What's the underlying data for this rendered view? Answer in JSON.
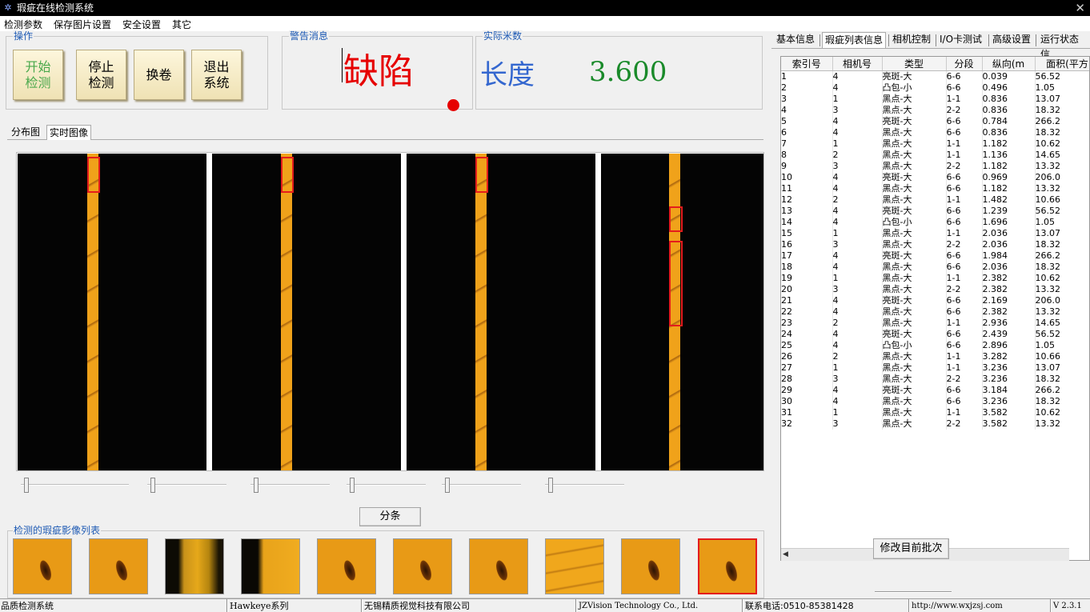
{
  "window": {
    "title": "瑕疵在线检测系统",
    "close_glyph": "✕"
  },
  "menu": [
    "检测参数",
    "保存图片设置",
    "安全设置",
    "其它"
  ],
  "operation": {
    "title": "操作",
    "start": [
      "开始",
      "检测"
    ],
    "stop": [
      "停止",
      "检测"
    ],
    "change_roll": "换卷",
    "exit": [
      "退出",
      "系统"
    ]
  },
  "warning": {
    "title": "警告消息",
    "message": "缺陷",
    "indicator_color": "#e60000"
  },
  "meter": {
    "title": "实际米数",
    "label": "长度",
    "value": "3.600"
  },
  "view_tabs": {
    "distribution": "分布图",
    "realtime": "实时图像",
    "active": "实时图像"
  },
  "split_button": "分条",
  "thumbs_title": "检测的瑕疵影像列表",
  "right_tabs": [
    "基本信息",
    "瑕疵列表信息",
    "相机控制",
    "I/O卡测试",
    "高级设置",
    "运行状态信"
  ],
  "right_active_tab": "瑕疵列表信息",
  "table": {
    "headers": [
      "索引号",
      "相机号",
      "类型",
      "分段",
      "纵向(m",
      "面积(平方"
    ],
    "rows": [
      [
        "1",
        "4",
        "亮斑-大",
        "6-6",
        "0.039",
        "56.52"
      ],
      [
        "2",
        "4",
        "凸包-小",
        "6-6",
        "0.496",
        "1.05"
      ],
      [
        "3",
        "1",
        "黑点-大",
        "1-1",
        "0.836",
        "13.07"
      ],
      [
        "4",
        "3",
        "黑点-大",
        "2-2",
        "0.836",
        "18.32"
      ],
      [
        "5",
        "4",
        "亮斑-大",
        "6-6",
        "0.784",
        "266.2"
      ],
      [
        "6",
        "4",
        "黑点-大",
        "6-6",
        "0.836",
        "18.32"
      ],
      [
        "7",
        "1",
        "黑点-大",
        "1-1",
        "1.182",
        "10.62"
      ],
      [
        "8",
        "2",
        "黑点-大",
        "1-1",
        "1.136",
        "14.65"
      ],
      [
        "9",
        "3",
        "黑点-大",
        "2-2",
        "1.182",
        "13.32"
      ],
      [
        "10",
        "4",
        "亮斑-大",
        "6-6",
        "0.969",
        "206.0"
      ],
      [
        "11",
        "4",
        "黑点-大",
        "6-6",
        "1.182",
        "13.32"
      ],
      [
        "12",
        "2",
        "黑点-大",
        "1-1",
        "1.482",
        "10.66"
      ],
      [
        "13",
        "4",
        "亮斑-大",
        "6-6",
        "1.239",
        "56.52"
      ],
      [
        "14",
        "4",
        "凸包-小",
        "6-6",
        "1.696",
        "1.05"
      ],
      [
        "15",
        "1",
        "黑点-大",
        "1-1",
        "2.036",
        "13.07"
      ],
      [
        "16",
        "3",
        "黑点-大",
        "2-2",
        "2.036",
        "18.32"
      ],
      [
        "17",
        "4",
        "亮斑-大",
        "6-6",
        "1.984",
        "266.2"
      ],
      [
        "18",
        "4",
        "黑点-大",
        "6-6",
        "2.036",
        "18.32"
      ],
      [
        "19",
        "1",
        "黑点-大",
        "1-1",
        "2.382",
        "10.62"
      ],
      [
        "20",
        "3",
        "黑点-大",
        "2-2",
        "2.382",
        "13.32"
      ],
      [
        "21",
        "4",
        "亮斑-大",
        "6-6",
        "2.169",
        "206.0"
      ],
      [
        "22",
        "4",
        "黑点-大",
        "6-6",
        "2.382",
        "13.32"
      ],
      [
        "23",
        "2",
        "黑点-大",
        "1-1",
        "2.936",
        "14.65"
      ],
      [
        "24",
        "4",
        "亮斑-大",
        "6-6",
        "2.439",
        "56.52"
      ],
      [
        "25",
        "4",
        "凸包-小",
        "6-6",
        "2.896",
        "1.05"
      ],
      [
        "26",
        "2",
        "黑点-大",
        "1-1",
        "3.282",
        "10.66"
      ],
      [
        "27",
        "1",
        "黑点-大",
        "1-1",
        "3.236",
        "13.07"
      ],
      [
        "28",
        "3",
        "黑点-大",
        "2-2",
        "3.236",
        "18.32"
      ],
      [
        "29",
        "4",
        "亮斑-大",
        "6-6",
        "3.184",
        "266.2"
      ],
      [
        "30",
        "4",
        "黑点-大",
        "6-6",
        "3.236",
        "18.32"
      ],
      [
        "31",
        "1",
        "黑点-大",
        "1-1",
        "3.582",
        "10.62"
      ],
      [
        "32",
        "3",
        "黑点-大",
        "2-2",
        "3.582",
        "13.32"
      ]
    ]
  },
  "modify_batch_button": "修改目前批次",
  "status": {
    "product": "品质检测系统",
    "series": "Hawkeye系列",
    "company_cn": "无锡精质视觉科技有限公司",
    "company_en": "JZVision Technology Co., Ltd.",
    "phone": "联系电话:0510-85381428",
    "website": "http://www.wxjzsj.com",
    "version": "V 2.3.1"
  },
  "colors": {
    "accent_blue": "#1e5ab4",
    "alert_red": "#e60000",
    "value_green": "#1a8a2a",
    "label_blue": "#3467cf",
    "fabric_orange": "#f0a21a"
  }
}
